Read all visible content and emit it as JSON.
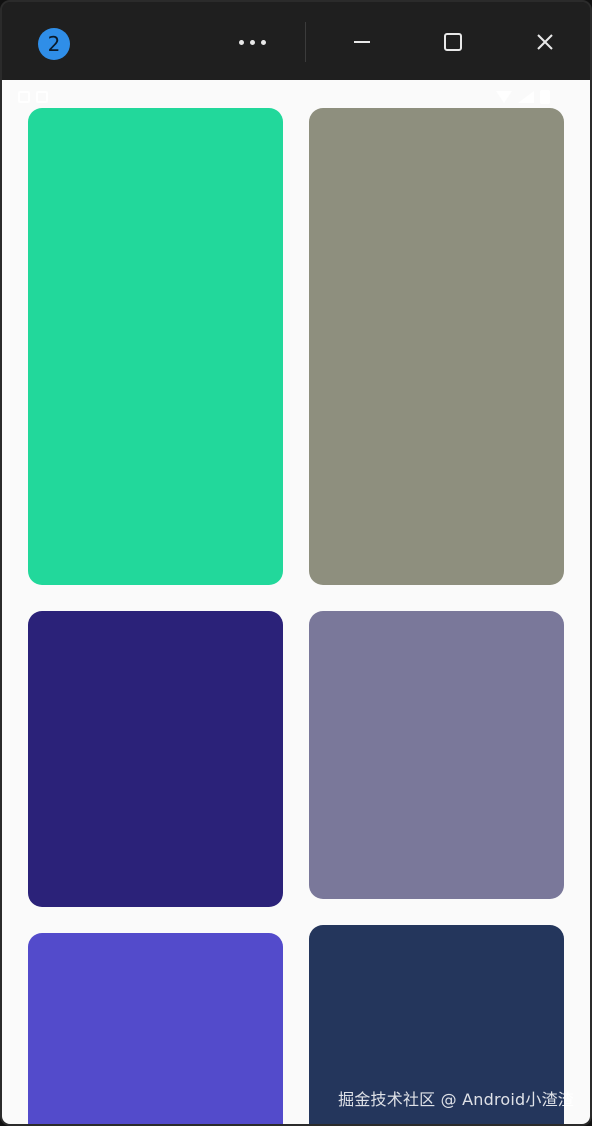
{
  "titlebar": {
    "badge_number": "2",
    "icons": {
      "menu": "more-horizontal-icon",
      "minimize": "minimize-icon",
      "maximize": "maximize-icon",
      "close": "close-icon"
    },
    "icon_color": "#e8e8e8",
    "accent": "#2f8ee8"
  },
  "content": {
    "background": "#fafafa",
    "cards": [
      {
        "name": "card-1",
        "color": "#22d89b"
      },
      {
        "name": "card-2",
        "color": "#8e8f7e"
      },
      {
        "name": "card-3",
        "color": "#2b2279"
      },
      {
        "name": "card-4",
        "color": "#7a789a"
      },
      {
        "name": "card-5",
        "color": "#534bcb"
      },
      {
        "name": "card-6",
        "color": "#24365c"
      }
    ]
  },
  "status_bar": {
    "left_icons": [
      "status-icon-1",
      "status-icon-2"
    ],
    "right_icons": [
      "wifi-icon",
      "signal-icon",
      "battery-icon"
    ]
  },
  "watermark": {
    "text": "掘金技术社区 @ Android小渣渣"
  }
}
